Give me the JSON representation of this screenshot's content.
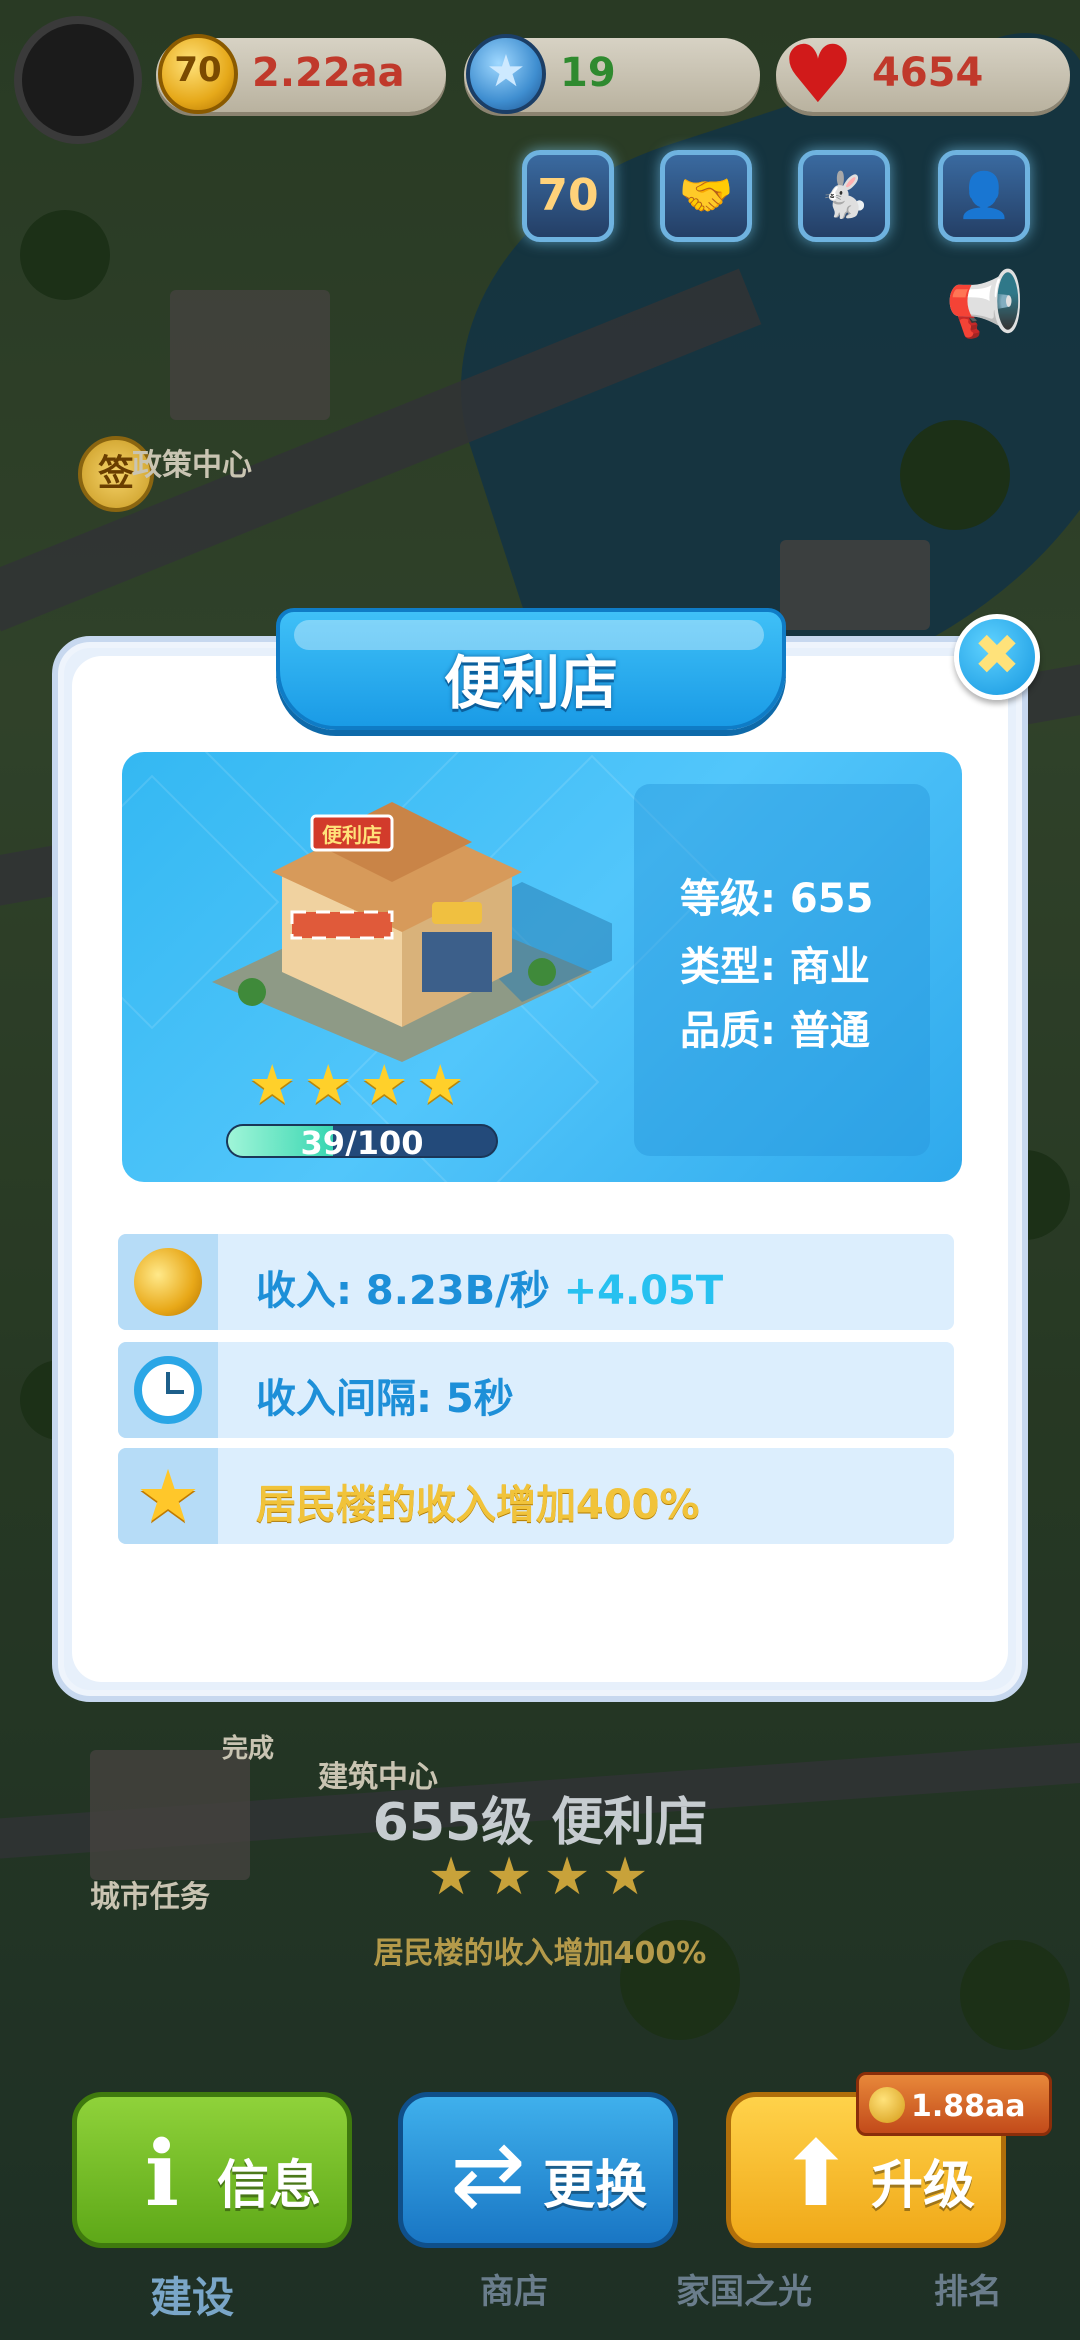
{
  "top_bar": {
    "coins": {
      "icon_text": "70",
      "value": "2.22aa"
    },
    "stars": {
      "value": "19"
    },
    "hearts": {
      "value": "4654"
    },
    "buttons": [
      {
        "name": "sale-70-button",
        "glyph": "70"
      },
      {
        "name": "handshake-button",
        "glyph": "🤝"
      },
      {
        "name": "mascot-button",
        "glyph": "🐇"
      },
      {
        "name": "customer-service-button",
        "glyph": "👤"
      }
    ]
  },
  "map": {
    "sign_badge": "签",
    "labels": {
      "policy_center": "政策中心",
      "build_center": "建筑中心",
      "city_tasks": "城市任务",
      "complete": "完成"
    }
  },
  "modal": {
    "title": "便利店",
    "close_icon": "✖",
    "building": {
      "sign": "便利店",
      "stars_count": 4,
      "progress": {
        "text": "39/100",
        "current": 39,
        "max": 100
      }
    },
    "stats": {
      "level": "等级: 655",
      "type": "类型: 商业",
      "quality": "品质: 普通"
    },
    "rows": {
      "income": {
        "label": "收入: 8.23B/秒",
        "extra": "+4.05T"
      },
      "interval": {
        "label": "收入间隔: 5秒"
      },
      "bonus": {
        "label": "居民楼的收入增加400%"
      }
    }
  },
  "bottom": {
    "title": "655级 便利店",
    "stars_count": 4,
    "bonus_text": "居民楼的收入增加400%",
    "actions": {
      "info": "信息",
      "swap": "更换",
      "upgrade": "升级",
      "upgrade_cost": "1.88aa"
    },
    "nav": {
      "build": "建设",
      "shop": "商店",
      "homeland": "家国之光",
      "rank": "排名"
    }
  },
  "colors": {
    "accent_blue": "#1d8fd8",
    "gold": "#f1c33a",
    "coin_text": "#c0392b",
    "star_text": "#2f8a2f",
    "heart_text": "#c0392b"
  }
}
